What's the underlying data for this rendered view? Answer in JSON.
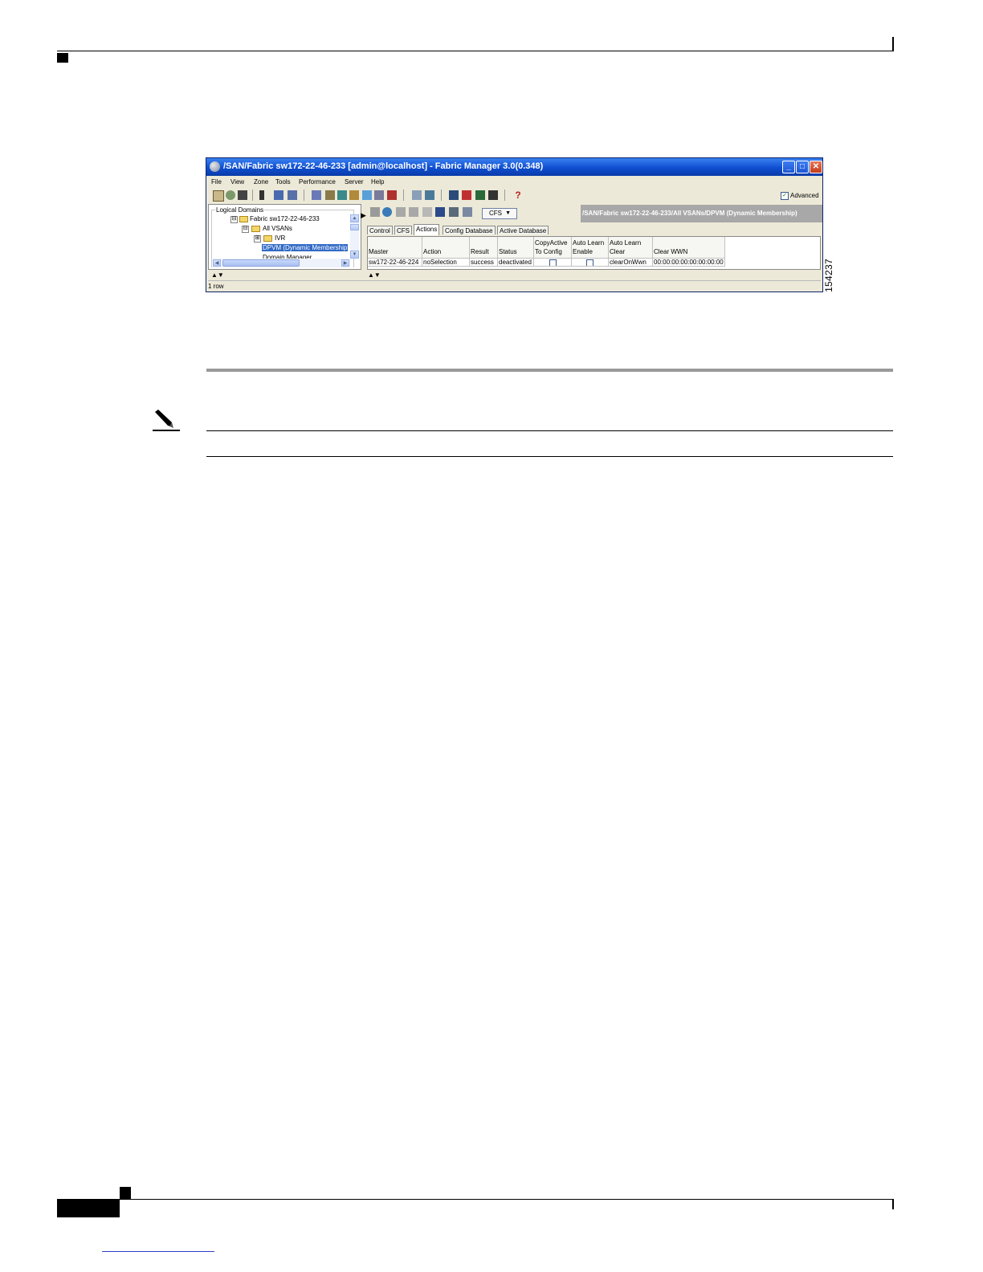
{
  "window": {
    "title": "/SAN/Fabric sw172-22-46-233 [admin@localhost] - Fabric Manager 3.0(0.348)",
    "controls": {
      "minimize": "_",
      "maximize": "□",
      "close": "✕"
    }
  },
  "menu": [
    "File",
    "View",
    "Zone",
    "Tools",
    "Performance",
    "Server",
    "Help"
  ],
  "toolbar": {
    "advanced_label": "Advanced",
    "advanced_checked": true
  },
  "left_panel": {
    "title": "Logical Domains",
    "tree": [
      {
        "label": "Fabric sw172-22-46-233",
        "expander": "⊟",
        "icon": "folder-icon"
      },
      {
        "label": "All VSANs",
        "expander": "⊟",
        "icon": "folder-icon"
      },
      {
        "label": "IVR",
        "expander": "⊞",
        "icon": "folder-icon"
      },
      {
        "label": "DPVM (Dynamic Membership",
        "selected": true
      },
      {
        "label": "Domain Manager"
      }
    ]
  },
  "right_panel": {
    "cfs_button": "CFS",
    "path": "/SAN/Fabric sw172-22-46-233/All VSANs/DPVM (Dynamic Membership)",
    "tabs": [
      {
        "label": "Control"
      },
      {
        "label": "CFS"
      },
      {
        "label": "Actions",
        "active": true
      },
      {
        "label": "Config Database"
      },
      {
        "label": "Active Database"
      }
    ],
    "table": {
      "headers": [
        {
          "line1": "",
          "line2": "Master"
        },
        {
          "line1": "",
          "line2": "Action"
        },
        {
          "line1": "",
          "line2": "Result"
        },
        {
          "line1": "",
          "line2": "Status"
        },
        {
          "line1": "CopyActive",
          "line2": "To Config"
        },
        {
          "line1": "Auto Learn",
          "line2": "Enable"
        },
        {
          "line1": "Auto Learn",
          "line2": "Clear"
        },
        {
          "line1": "",
          "line2": "Clear WWN"
        }
      ],
      "row": {
        "master": "sw172-22-46-224",
        "action": "noSelection",
        "result": "success",
        "status": "deactivated",
        "copy_active_to_config": false,
        "auto_learn_enable": false,
        "auto_learn_clear": "clearOnWwn",
        "clear_wwn": "00:00:00:00:00:00:00:00"
      }
    }
  },
  "status": "1 row",
  "figure_id": "154237"
}
